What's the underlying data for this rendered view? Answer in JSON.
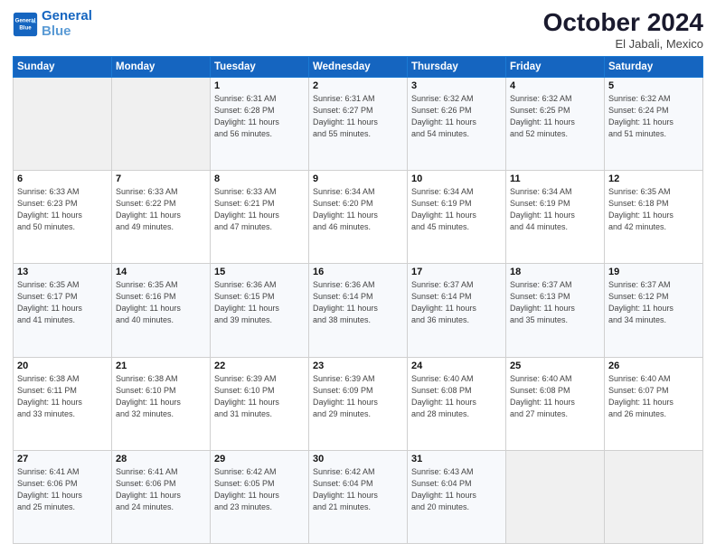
{
  "header": {
    "logo_line1": "General",
    "logo_line2": "Blue",
    "month": "October 2024",
    "location": "El Jabali, Mexico"
  },
  "weekdays": [
    "Sunday",
    "Monday",
    "Tuesday",
    "Wednesday",
    "Thursday",
    "Friday",
    "Saturday"
  ],
  "weeks": [
    [
      {
        "day": "",
        "detail": ""
      },
      {
        "day": "",
        "detail": ""
      },
      {
        "day": "1",
        "detail": "Sunrise: 6:31 AM\nSunset: 6:28 PM\nDaylight: 11 hours\nand 56 minutes."
      },
      {
        "day": "2",
        "detail": "Sunrise: 6:31 AM\nSunset: 6:27 PM\nDaylight: 11 hours\nand 55 minutes."
      },
      {
        "day": "3",
        "detail": "Sunrise: 6:32 AM\nSunset: 6:26 PM\nDaylight: 11 hours\nand 54 minutes."
      },
      {
        "day": "4",
        "detail": "Sunrise: 6:32 AM\nSunset: 6:25 PM\nDaylight: 11 hours\nand 52 minutes."
      },
      {
        "day": "5",
        "detail": "Sunrise: 6:32 AM\nSunset: 6:24 PM\nDaylight: 11 hours\nand 51 minutes."
      }
    ],
    [
      {
        "day": "6",
        "detail": "Sunrise: 6:33 AM\nSunset: 6:23 PM\nDaylight: 11 hours\nand 50 minutes."
      },
      {
        "day": "7",
        "detail": "Sunrise: 6:33 AM\nSunset: 6:22 PM\nDaylight: 11 hours\nand 49 minutes."
      },
      {
        "day": "8",
        "detail": "Sunrise: 6:33 AM\nSunset: 6:21 PM\nDaylight: 11 hours\nand 47 minutes."
      },
      {
        "day": "9",
        "detail": "Sunrise: 6:34 AM\nSunset: 6:20 PM\nDaylight: 11 hours\nand 46 minutes."
      },
      {
        "day": "10",
        "detail": "Sunrise: 6:34 AM\nSunset: 6:19 PM\nDaylight: 11 hours\nand 45 minutes."
      },
      {
        "day": "11",
        "detail": "Sunrise: 6:34 AM\nSunset: 6:19 PM\nDaylight: 11 hours\nand 44 minutes."
      },
      {
        "day": "12",
        "detail": "Sunrise: 6:35 AM\nSunset: 6:18 PM\nDaylight: 11 hours\nand 42 minutes."
      }
    ],
    [
      {
        "day": "13",
        "detail": "Sunrise: 6:35 AM\nSunset: 6:17 PM\nDaylight: 11 hours\nand 41 minutes."
      },
      {
        "day": "14",
        "detail": "Sunrise: 6:35 AM\nSunset: 6:16 PM\nDaylight: 11 hours\nand 40 minutes."
      },
      {
        "day": "15",
        "detail": "Sunrise: 6:36 AM\nSunset: 6:15 PM\nDaylight: 11 hours\nand 39 minutes."
      },
      {
        "day": "16",
        "detail": "Sunrise: 6:36 AM\nSunset: 6:14 PM\nDaylight: 11 hours\nand 38 minutes."
      },
      {
        "day": "17",
        "detail": "Sunrise: 6:37 AM\nSunset: 6:14 PM\nDaylight: 11 hours\nand 36 minutes."
      },
      {
        "day": "18",
        "detail": "Sunrise: 6:37 AM\nSunset: 6:13 PM\nDaylight: 11 hours\nand 35 minutes."
      },
      {
        "day": "19",
        "detail": "Sunrise: 6:37 AM\nSunset: 6:12 PM\nDaylight: 11 hours\nand 34 minutes."
      }
    ],
    [
      {
        "day": "20",
        "detail": "Sunrise: 6:38 AM\nSunset: 6:11 PM\nDaylight: 11 hours\nand 33 minutes."
      },
      {
        "day": "21",
        "detail": "Sunrise: 6:38 AM\nSunset: 6:10 PM\nDaylight: 11 hours\nand 32 minutes."
      },
      {
        "day": "22",
        "detail": "Sunrise: 6:39 AM\nSunset: 6:10 PM\nDaylight: 11 hours\nand 31 minutes."
      },
      {
        "day": "23",
        "detail": "Sunrise: 6:39 AM\nSunset: 6:09 PM\nDaylight: 11 hours\nand 29 minutes."
      },
      {
        "day": "24",
        "detail": "Sunrise: 6:40 AM\nSunset: 6:08 PM\nDaylight: 11 hours\nand 28 minutes."
      },
      {
        "day": "25",
        "detail": "Sunrise: 6:40 AM\nSunset: 6:08 PM\nDaylight: 11 hours\nand 27 minutes."
      },
      {
        "day": "26",
        "detail": "Sunrise: 6:40 AM\nSunset: 6:07 PM\nDaylight: 11 hours\nand 26 minutes."
      }
    ],
    [
      {
        "day": "27",
        "detail": "Sunrise: 6:41 AM\nSunset: 6:06 PM\nDaylight: 11 hours\nand 25 minutes."
      },
      {
        "day": "28",
        "detail": "Sunrise: 6:41 AM\nSunset: 6:06 PM\nDaylight: 11 hours\nand 24 minutes."
      },
      {
        "day": "29",
        "detail": "Sunrise: 6:42 AM\nSunset: 6:05 PM\nDaylight: 11 hours\nand 23 minutes."
      },
      {
        "day": "30",
        "detail": "Sunrise: 6:42 AM\nSunset: 6:04 PM\nDaylight: 11 hours\nand 21 minutes."
      },
      {
        "day": "31",
        "detail": "Sunrise: 6:43 AM\nSunset: 6:04 PM\nDaylight: 11 hours\nand 20 minutes."
      },
      {
        "day": "",
        "detail": ""
      },
      {
        "day": "",
        "detail": ""
      }
    ]
  ]
}
